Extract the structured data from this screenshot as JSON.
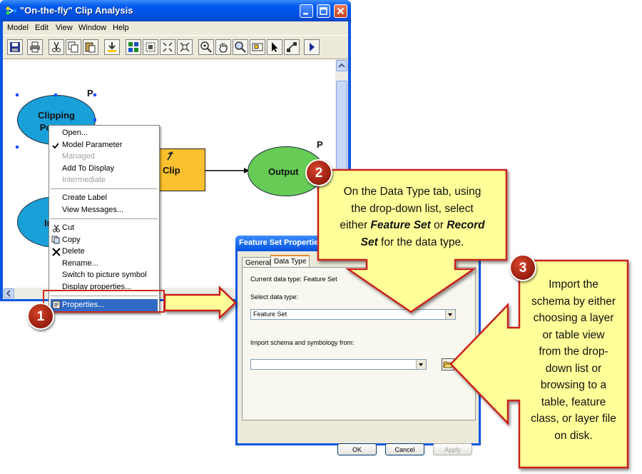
{
  "window": {
    "title": "\"On-the-fly\" Clip Analysis",
    "menus": [
      "Model",
      "Edit",
      "View",
      "Window",
      "Help"
    ]
  },
  "model": {
    "clipping_label_line1": "Clipping",
    "clipping_label_line2": "Po",
    "input_label": "In",
    "clip_label": "Clip",
    "output_label": "Output",
    "parameter_marker": "P"
  },
  "context_menu": {
    "items": [
      "Open...",
      "Model Parameter",
      "Managed",
      "Add To Display",
      "Intermediate",
      "Create Label",
      "View Messages...",
      "Cut",
      "Copy",
      "Delete",
      "Rename...",
      "Switch to picture symbol",
      "Display properties...",
      "Properties..."
    ]
  },
  "dialog": {
    "title": "Feature Set Properties",
    "tabs": [
      "General",
      "Data Type"
    ],
    "current_type_label": "Current data type: Feature Set",
    "select_label": "Select data type:",
    "select_value": "Feature Set",
    "import_label": "Import schema and symbology from:",
    "import_value": "",
    "ok": "OK",
    "cancel": "Cancel",
    "apply": "Apply"
  },
  "callouts": {
    "c1": {
      "number": "1"
    },
    "c2": {
      "number": "2",
      "line1": "On the Data Type tab, using",
      "line2": "the drop-down list, select",
      "line3_pre": "either ",
      "line3_em": "Feature Set",
      "line3_mid": " or ",
      "line3_em2": "Record",
      "line4_em": "Set",
      "line4_post": " for the data type."
    },
    "c3": {
      "number": "3",
      "lines": [
        "Import the",
        "schema by either",
        "choosing a layer",
        "or table view",
        "from the drop-",
        "down list or",
        "browsing to a",
        "table, feature",
        "class, or layer file",
        "on disk."
      ]
    }
  },
  "colors": {
    "clipping_fill": "#1aa0d8",
    "clip_tool_fill": "#fbc02d",
    "output_fill": "#66cc55",
    "callout_fill": "#ffff99",
    "callout_border": "#c8231a",
    "badge": "#b8301c"
  }
}
